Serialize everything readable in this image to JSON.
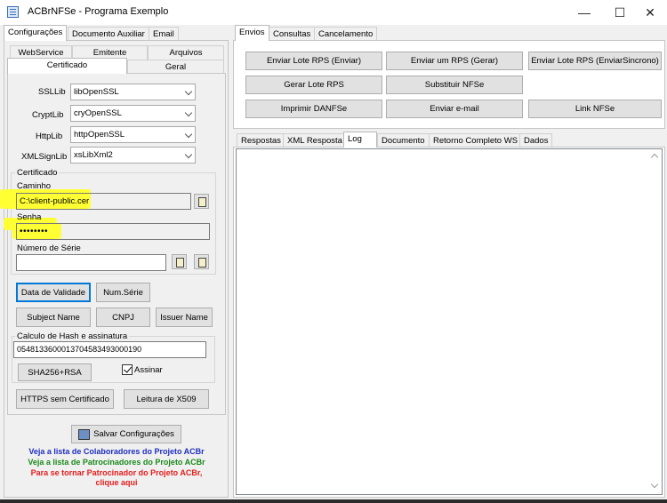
{
  "window": {
    "title": "ACBrNFSe - Programa Exemplo",
    "minimize": "—",
    "maximize": "☐",
    "close": "✕"
  },
  "left": {
    "tabs": [
      "Configurações",
      "Documento Auxiliar",
      "Email"
    ],
    "subtabs_row1": [
      "WebService",
      "Emitente",
      "Arquivos"
    ],
    "subtabs_row2": [
      "Certificado",
      "Geral"
    ],
    "libs": [
      {
        "label": "SSLLib",
        "value": "libOpenSSL"
      },
      {
        "label": "CryptLib",
        "value": "cryOpenSSL"
      },
      {
        "label": "HttpLib",
        "value": "httpOpenSSL"
      },
      {
        "label": "XMLSignLib",
        "value": "xsLibXml2"
      }
    ],
    "cert": {
      "group": "Certificado",
      "caminho_label": "Caminho",
      "caminho_value": "C:\\client-public.cer",
      "senha_label": "Senha",
      "senha_value": "••••••••",
      "serie_label": "Número de Série",
      "serie_value": ""
    },
    "buttons": {
      "validade": "Data de Validade",
      "numserie": "Num.Série",
      "subject": "Subject Name",
      "cnpj": "CNPJ",
      "issuer": "Issuer Name"
    },
    "hash": {
      "group": "Calculo de Hash e assinatura",
      "value": "05481336000137045834930001​90",
      "sha_button": "SHA256+RSA",
      "assinar_label": "Assinar"
    },
    "https_button": "HTTPS sem Certificado",
    "x509_button": "Leitura de X509",
    "salvar_button": "Salvar Configurações",
    "links": [
      {
        "text": "Veja a lista de Colaboradores do Projeto ACBr",
        "color": "#1f2fbf"
      },
      {
        "text": "Veja a lista de Patrocinadores do Projeto ACBr",
        "color": "#1a8a1a"
      },
      {
        "text": "Para se tornar Patrocinador do Projeto ACBr,",
        "color": "#e51c1c"
      },
      {
        "text": "clique aqui",
        "color": "#e51c1c"
      }
    ]
  },
  "right": {
    "tabs": [
      "Envios",
      "Consultas",
      "Cancelamento"
    ],
    "buttons": {
      "enviar_lote": "Enviar Lote RPS (Enviar)",
      "enviar_um": "Enviar um RPS (Gerar)",
      "enviar_sinc": "Enviar Lote RPS (EnviarSincrono)",
      "gerar_lote": "Gerar Lote RPS",
      "substituir": "Substituir NFSe",
      "imprimir": "Imprimir DANFSe",
      "email": "Enviar e-mail",
      "link": "Link NFSe"
    },
    "result_tabs": [
      "Respostas",
      "XML Resposta",
      "Log",
      "Documento",
      "Retorno Completo WS",
      "Dados"
    ]
  }
}
